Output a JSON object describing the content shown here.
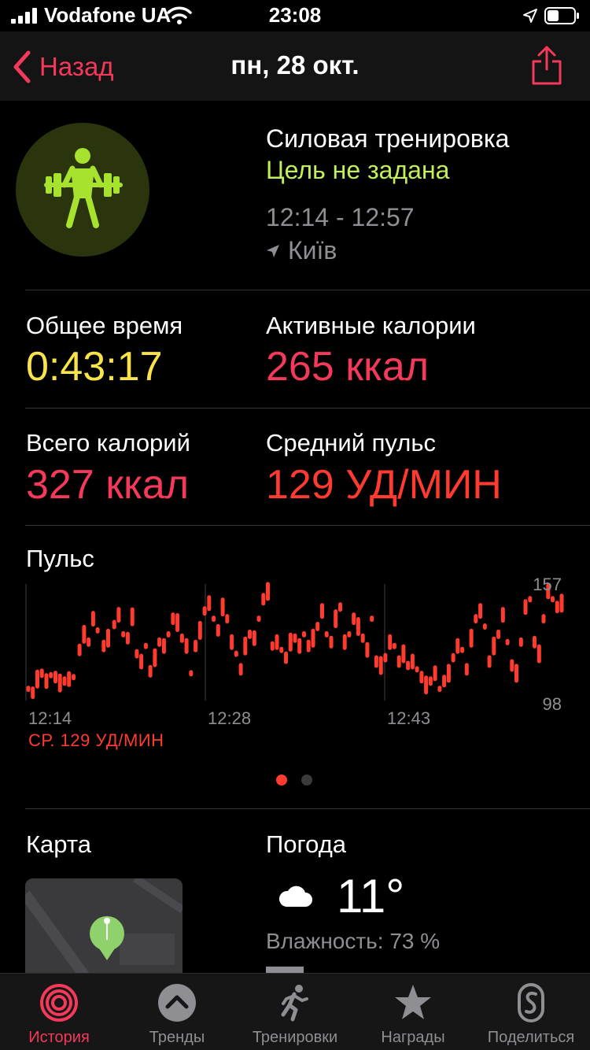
{
  "status": {
    "carrier": "Vodafone UA",
    "time": "23:08"
  },
  "nav": {
    "back_label": "Назад",
    "title": "пн, 28 окт."
  },
  "workout": {
    "title": "Силовая тренировка",
    "goal": "Цель не задана",
    "time_range": "12:14 - 12:57",
    "location": "Київ"
  },
  "stats": {
    "total_time_label": "Общее время",
    "total_time_value": "0:43:17",
    "active_cal_label": "Активные калории",
    "active_cal_value": "265 ккал",
    "total_cal_label": "Всего калорий",
    "total_cal_value": "327 ккал",
    "avg_hr_label": "Средний пульс",
    "avg_hr_value": "129 УД/МИН"
  },
  "heart_chart": {
    "title": "Пульс",
    "max_label": "157",
    "min_label": "98",
    "x_labels": [
      "12:14",
      "12:28",
      "12:43"
    ],
    "avg_label": "СР. 129 УД/МИН"
  },
  "chart_data": {
    "type": "scatter",
    "title": "Пульс",
    "ylim": [
      98,
      157
    ],
    "x_ticks": [
      "12:14",
      "12:28",
      "12:43"
    ],
    "series": [
      {
        "color": "#ff3b30",
        "points": [
          [
            0.0,
            104
          ],
          [
            0.3,
            102
          ],
          [
            0.6,
            109
          ],
          [
            0.9,
            112
          ],
          [
            1.2,
            108
          ],
          [
            1.5,
            111
          ],
          [
            1.8,
            110
          ],
          [
            2.1,
            107
          ],
          [
            2.4,
            108
          ],
          [
            2.7,
            109
          ],
          [
            3.0,
            110
          ],
          [
            3.4,
            124
          ],
          [
            3.7,
            132
          ],
          [
            4.0,
            128
          ],
          [
            4.3,
            140
          ],
          [
            4.6,
            134
          ],
          [
            5.0,
            126
          ],
          [
            5.3,
            130
          ],
          [
            5.7,
            137
          ],
          [
            6.0,
            142
          ],
          [
            6.3,
            132
          ],
          [
            6.6,
            130
          ],
          [
            6.9,
            141
          ],
          [
            7.2,
            122
          ],
          [
            7.5,
            118
          ],
          [
            7.8,
            126
          ],
          [
            8.1,
            113
          ],
          [
            8.4,
            120
          ],
          [
            8.7,
            128
          ],
          [
            9.0,
            126
          ],
          [
            9.3,
            132
          ],
          [
            9.6,
            140
          ],
          [
            9.9,
            138
          ],
          [
            10.2,
            130
          ],
          [
            10.5,
            126
          ],
          [
            10.8,
            112
          ],
          [
            11.1,
            126
          ],
          [
            11.4,
            134
          ],
          [
            11.7,
            144
          ],
          [
            12.0,
            148
          ],
          [
            12.3,
            140
          ],
          [
            12.6,
            134
          ],
          [
            12.9,
            146
          ],
          [
            13.2,
            140
          ],
          [
            13.5,
            128
          ],
          [
            13.8,
            122
          ],
          [
            14.1,
            114
          ],
          [
            14.4,
            126
          ],
          [
            14.7,
            132
          ],
          [
            15.0,
            130
          ],
          [
            15.3,
            140
          ],
          [
            15.6,
            150
          ],
          [
            15.9,
            154
          ],
          [
            16.2,
            126
          ],
          [
            16.5,
            128
          ],
          [
            16.8,
            124
          ],
          [
            17.1,
            120
          ],
          [
            17.4,
            128
          ],
          [
            17.7,
            130
          ],
          [
            18.0,
            126
          ],
          [
            18.3,
            132
          ],
          [
            18.6,
            126
          ],
          [
            18.9,
            130
          ],
          [
            19.2,
            136
          ],
          [
            19.5,
            144
          ],
          [
            19.8,
            132
          ],
          [
            20.1,
            128
          ],
          [
            20.4,
            140
          ],
          [
            20.7,
            146
          ],
          [
            21.0,
            128
          ],
          [
            21.3,
            132
          ],
          [
            21.6,
            140
          ],
          [
            21.9,
            136
          ],
          [
            22.2,
            130
          ],
          [
            22.5,
            124
          ],
          [
            22.8,
            140
          ],
          [
            23.1,
            118
          ],
          [
            23.4,
            116
          ],
          [
            23.7,
            120
          ],
          [
            24.0,
            128
          ],
          [
            24.3,
            126
          ],
          [
            24.6,
            118
          ],
          [
            24.9,
            122
          ],
          [
            25.2,
            116
          ],
          [
            25.5,
            118
          ],
          [
            25.8,
            114
          ],
          [
            26.1,
            110
          ],
          [
            26.4,
            106
          ],
          [
            26.7,
            108
          ],
          [
            27.0,
            112
          ],
          [
            27.3,
            104
          ],
          [
            27.6,
            108
          ],
          [
            27.9,
            112
          ],
          [
            28.2,
            120
          ],
          [
            28.5,
            126
          ],
          [
            28.8,
            124
          ],
          [
            29.1,
            114
          ],
          [
            29.4,
            130
          ],
          [
            29.7,
            140
          ],
          [
            30.0,
            144
          ],
          [
            30.3,
            136
          ],
          [
            30.6,
            118
          ],
          [
            30.9,
            126
          ],
          [
            31.2,
            132
          ],
          [
            31.5,
            142
          ],
          [
            31.8,
            128
          ],
          [
            32.1,
            116
          ],
          [
            32.4,
            112
          ],
          [
            32.7,
            128
          ],
          [
            33.0,
            146
          ],
          [
            33.3,
            150
          ],
          [
            33.6,
            128
          ],
          [
            33.9,
            122
          ],
          [
            34.2,
            140
          ],
          [
            34.5,
            154
          ],
          [
            34.8,
            150
          ],
          [
            35.1,
            146
          ],
          [
            35.4,
            148
          ]
        ]
      }
    ]
  },
  "pager": {
    "count": 2,
    "active": 0
  },
  "map": {
    "title": "Карта"
  },
  "weather": {
    "title": "Погода",
    "icon": "cloud-icon",
    "temperature": "11°",
    "humidity": "Влажность: 73 %"
  },
  "tabs": [
    {
      "label": "История",
      "icon": "history-rings-icon"
    },
    {
      "label": "Тренды",
      "icon": "trends-icon"
    },
    {
      "label": "Тренировки",
      "icon": "workout-runner-icon"
    },
    {
      "label": "Награды",
      "icon": "awards-star-icon"
    },
    {
      "label": "Поделиться",
      "icon": "sharing-icon"
    }
  ],
  "colors": {
    "accent": "#f4395a",
    "goal": "#c2f05a",
    "time": "#f9e34a",
    "hr": "#ff3b30"
  }
}
